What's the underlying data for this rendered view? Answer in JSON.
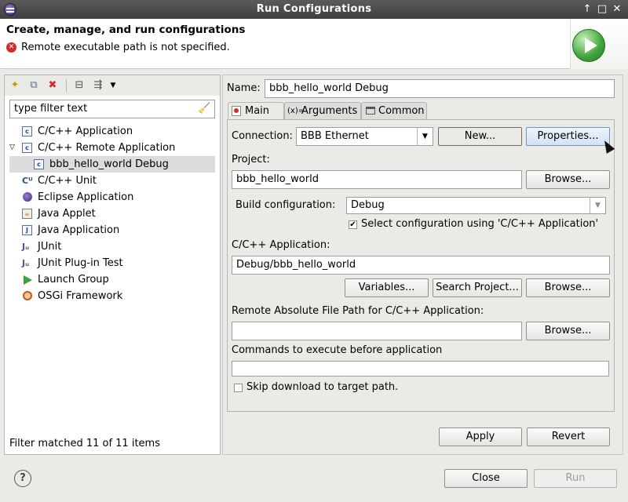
{
  "window": {
    "title": "Run Configurations",
    "controls": [
      "↑",
      "□",
      "✕"
    ]
  },
  "banner": {
    "title": "Create, manage, and run configurations",
    "message": "Remote executable path is not specified."
  },
  "left": {
    "filter_placeholder": "type filter text",
    "status": "Filter matched 11 of 11 items",
    "tree": [
      {
        "label": "C/C++ Application"
      },
      {
        "label": "C/C++ Remote Application"
      },
      {
        "label": "bbb_hello_world Debug"
      },
      {
        "label": "C/C++ Unit"
      },
      {
        "label": "Eclipse Application"
      },
      {
        "label": "Java Applet"
      },
      {
        "label": "Java Application"
      },
      {
        "label": "JUnit"
      },
      {
        "label": "JUnit Plug-in Test"
      },
      {
        "label": "Launch Group"
      },
      {
        "label": "OSGi Framework"
      }
    ]
  },
  "right": {
    "name_label": "Name:",
    "name_value": "bbb_hello_world Debug",
    "tabs": [
      {
        "label": "Main"
      },
      {
        "label": "Arguments"
      },
      {
        "label": "Common"
      }
    ],
    "connection_label": "Connection:",
    "connection_value": "BBB Ethernet",
    "new_button": "New...",
    "properties_button": "Properties...",
    "project_label": "Project:",
    "project_value": "bbb_hello_world",
    "browse_label": "Browse...",
    "build_config_label": "Build configuration:",
    "build_config_value": "Debug",
    "select_config_label": "Select configuration using 'C/C++ Application'",
    "app_label": "C/C++ Application:",
    "app_value": "Debug/bbb_hello_world",
    "variables_button": "Variables...",
    "search_project_button": "Search Project...",
    "remote_path_label": "Remote Absolute File Path for C/C++ Application:",
    "remote_path_value": "",
    "commands_label": "Commands to execute before application",
    "commands_value": "",
    "skip_download_label": "Skip download to target path.",
    "apply_button": "Apply",
    "revert_button": "Revert"
  },
  "footer": {
    "close_button": "Close",
    "run_button": "Run"
  },
  "colors": {
    "titlebar": "#4a4a4a",
    "error": "#d42a2a",
    "run_green": "#3da33a",
    "selection": "#dcdcdc"
  }
}
